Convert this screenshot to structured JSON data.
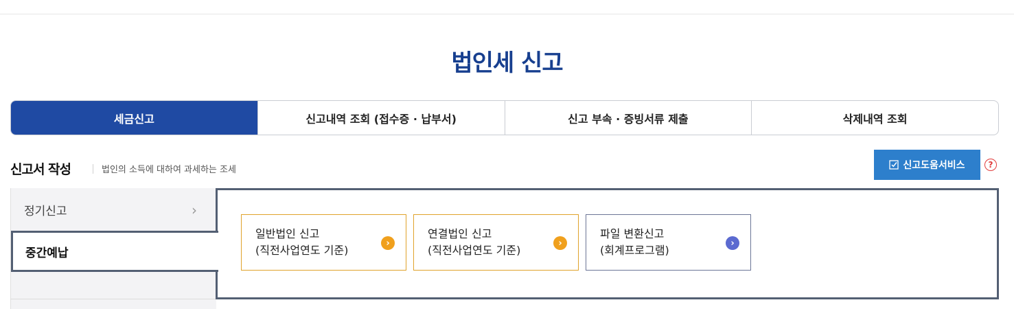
{
  "page": {
    "title": "법인세 신고"
  },
  "tabs": [
    {
      "label": "세금신고"
    },
    {
      "label": "신고내역 조회 (접수증 · 납부서)"
    },
    {
      "label": "신고 부속 · 증빙서류 제출"
    },
    {
      "label": "삭제내역 조회"
    }
  ],
  "section": {
    "title": "신고서 작성",
    "description": "법인의 소득에 대하여 과세하는 조세"
  },
  "help_service": {
    "label": "신고도움서비스",
    "question_glyph": "?"
  },
  "side_menu": {
    "items": [
      {
        "label": "정기신고",
        "chevron": "›"
      },
      {
        "label": "중간예납"
      }
    ]
  },
  "cards": [
    {
      "line1": "일반법인 신고",
      "line2": "(직전사업연도 기준)",
      "arrow": "›",
      "color": "#f0a01d"
    },
    {
      "line1": "연결법인 신고",
      "line2": "(직전사업연도 기준)",
      "arrow": "›",
      "color": "#f0a01d"
    },
    {
      "line1": "파일 변환신고",
      "line2": "(회계프로그램)",
      "arrow": "›",
      "color": "#5b6ad0"
    }
  ],
  "colors": {
    "accent": "#1f4aa3",
    "title": "#173f8f",
    "help_button": "#2d7fcc",
    "help_icon": "#e03a3a",
    "panel_border": "#535f73"
  }
}
